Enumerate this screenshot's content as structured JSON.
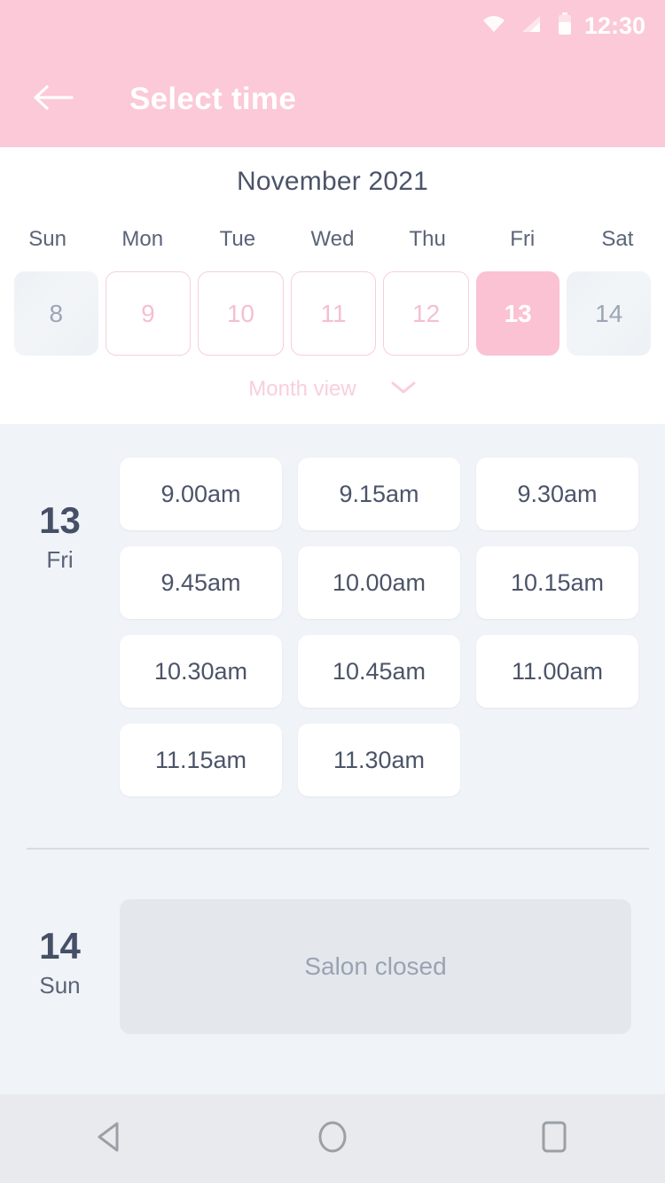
{
  "status_bar": {
    "time": "12:30",
    "icons": [
      "wifi-icon",
      "cellular-signal-icon",
      "battery-icon"
    ]
  },
  "app_bar": {
    "title": "Select time",
    "back_icon": "arrow-left-icon",
    "background_color": "#FBC9D7",
    "text_color": "#FFFFFF"
  },
  "calendar": {
    "month_title": "November 2021",
    "weekdays": [
      "Sun",
      "Mon",
      "Tue",
      "Wed",
      "Thu",
      "Fri",
      "Sat"
    ],
    "days": [
      {
        "number": "8",
        "state": "disabled"
      },
      {
        "number": "9",
        "state": "available"
      },
      {
        "number": "10",
        "state": "available"
      },
      {
        "number": "11",
        "state": "available"
      },
      {
        "number": "12",
        "state": "available"
      },
      {
        "number": "13",
        "state": "selected"
      },
      {
        "number": "14",
        "state": "disabled"
      }
    ],
    "month_view_label": "Month view",
    "month_view_icon": "chevron-down-icon",
    "accent_color": "#FBC2D4",
    "text_color": "#4B5468"
  },
  "schedule": [
    {
      "date_number": "13",
      "day_name": "Fri",
      "slots": [
        "9.00am",
        "9.15am",
        "9.30am",
        "9.45am",
        "10.00am",
        "10.15am",
        "10.30am",
        "10.45am",
        "11.00am",
        "11.15am",
        "11.30am"
      ],
      "closed_message": null
    },
    {
      "date_number": "14",
      "day_name": "Sun",
      "slots": [],
      "closed_message": "Salon closed"
    }
  ],
  "nav_bar": {
    "buttons": [
      "back-triangle-icon",
      "home-circle-icon",
      "recents-square-icon"
    ],
    "background_color": "#E8EAED"
  }
}
